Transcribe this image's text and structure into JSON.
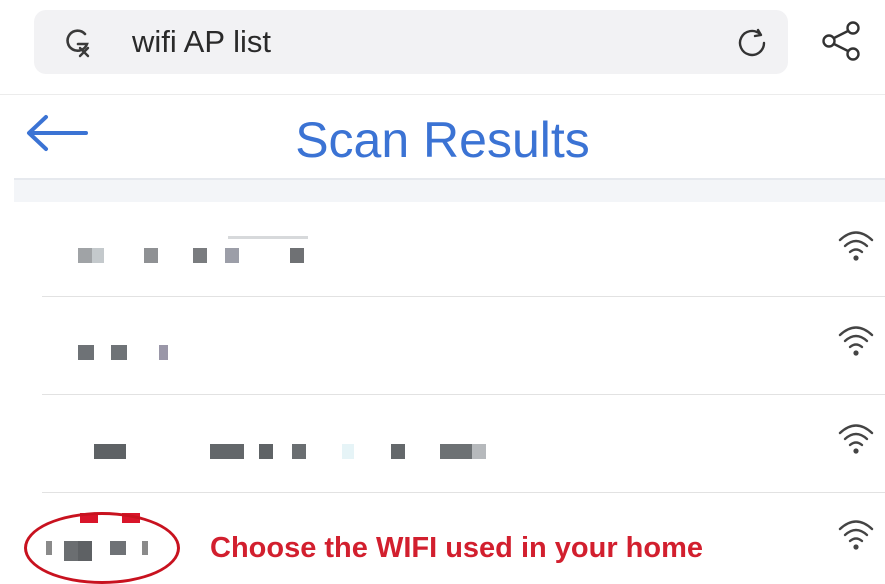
{
  "search": {
    "query": "wifi AP list"
  },
  "header": {
    "title": "Scan Results"
  },
  "networks": [
    {
      "signal": "full",
      "selected": false
    },
    {
      "signal": "full",
      "selected": false
    },
    {
      "signal": "full",
      "selected": false
    },
    {
      "signal": "full",
      "selected": true
    }
  ],
  "annotation": {
    "text": "Choose the WIFI used in your home",
    "color": "#d21f2e"
  },
  "colors": {
    "accent": "#3b73d4",
    "highlight": "#c8121f"
  },
  "icons": {
    "search_engine": "google-lens-icon",
    "refresh": "refresh-icon",
    "share": "share-icon",
    "back": "back-arrow-icon",
    "wifi": "wifi-icon"
  }
}
